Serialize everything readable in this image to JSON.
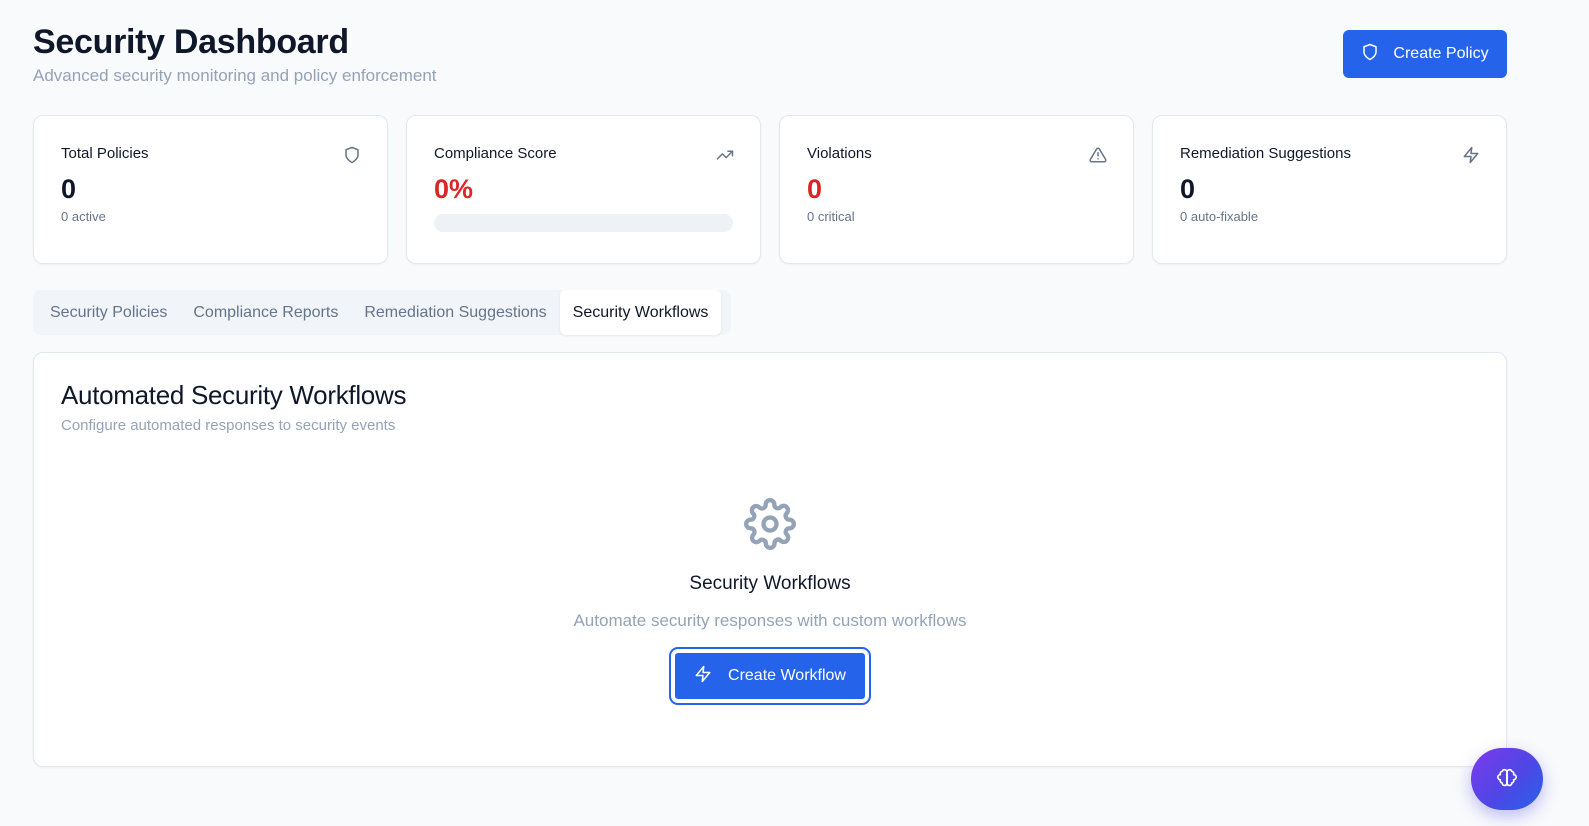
{
  "header": {
    "title": "Security Dashboard",
    "subtitle": "Advanced security monitoring and policy enforcement",
    "create_policy_label": "Create Policy",
    "create_policy_icon": "shield-icon"
  },
  "stats": [
    {
      "label": "Total Policies",
      "value": "0",
      "sub": "0 active",
      "icon": "shield-icon"
    },
    {
      "label": "Compliance Score",
      "value": "0%",
      "progress": 0,
      "icon": "trending-up-icon",
      "value_color": "#dc2626"
    },
    {
      "label": "Violations",
      "value": "0",
      "sub": "0 critical",
      "icon": "alert-triangle-icon",
      "value_color": "#dc2626"
    },
    {
      "label": "Remediation Suggestions",
      "value": "0",
      "sub": "0 auto-fixable",
      "icon": "zap-icon"
    }
  ],
  "tabs": [
    {
      "label": "Security Policies",
      "active": false
    },
    {
      "label": "Compliance Reports",
      "active": false
    },
    {
      "label": "Remediation Suggestions",
      "active": false
    },
    {
      "label": "Security Workflows",
      "active": true
    }
  ],
  "panel": {
    "title": "Automated Security Workflows",
    "subtitle": "Configure automated responses to security events",
    "empty_icon": "gear-icon",
    "empty_title": "Security Workflows",
    "empty_description": "Automate security responses with custom workflows",
    "create_workflow_label": "Create Workflow",
    "create_workflow_icon": "zap-icon"
  },
  "fab": {
    "icon": "brain-icon"
  },
  "colors": {
    "accent": "#2563eb",
    "danger": "#dc2626",
    "muted": "#94a3b8",
    "background": "#f8fafc"
  }
}
